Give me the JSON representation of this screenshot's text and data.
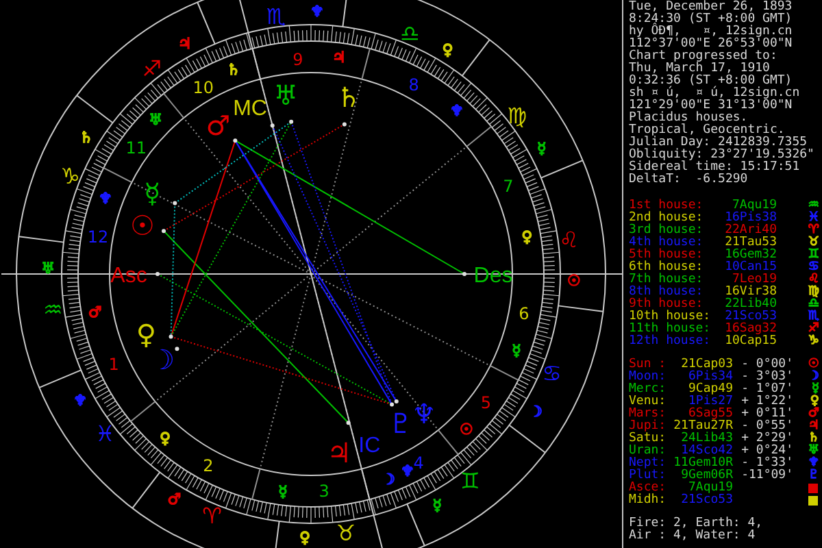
{
  "chart": {
    "signs": [
      {
        "glyph": "♈",
        "color": "#e00000",
        "ruler": {
          "glyph": "♂",
          "color": "#e00000"
        }
      },
      {
        "glyph": "♉",
        "color": "#d0d000",
        "ruler": {
          "glyph": "♀",
          "color": "#d0d000"
        }
      },
      {
        "glyph": "♊",
        "color": "#00c000",
        "ruler": {
          "glyph": "☿",
          "color": "#00c000"
        }
      },
      {
        "glyph": "♋",
        "color": "#1818ff",
        "ruler": {
          "glyph": "☽",
          "color": "#1818ff"
        }
      },
      {
        "glyph": "♌",
        "color": "#e00000",
        "ruler": {
          "glyph": "☉",
          "color": "#e00000"
        }
      },
      {
        "glyph": "♍",
        "color": "#d0d000",
        "ruler": {
          "glyph": "☿",
          "color": "#00c000"
        }
      },
      {
        "glyph": "♎",
        "color": "#00c000",
        "ruler": {
          "glyph": "♀",
          "color": "#d0d000"
        }
      },
      {
        "glyph": "♏",
        "color": "#1818ff",
        "ruler": {
          "glyph": "♆",
          "color": "#1818ff"
        }
      },
      {
        "glyph": "♐",
        "color": "#e00000",
        "ruler": {
          "glyph": "♃",
          "color": "#e00000"
        }
      },
      {
        "glyph": "♑",
        "color": "#d0d000",
        "ruler": {
          "glyph": "♄",
          "color": "#d0d000"
        }
      },
      {
        "glyph": "♒",
        "color": "#00c000",
        "ruler": {
          "glyph": "♅",
          "color": "#00c000"
        }
      },
      {
        "glyph": "♓",
        "color": "#1818ff",
        "ruler": {
          "glyph": "♆",
          "color": "#1818ff"
        }
      }
    ],
    "houses": [
      {
        "number": "1",
        "color": "#e00000",
        "rulers": [
          {
            "glyph": "♂",
            "color": "#e00000"
          }
        ]
      },
      {
        "number": "2",
        "color": "#d0d000",
        "rulers": [
          {
            "glyph": "♀",
            "color": "#d0d000"
          }
        ]
      },
      {
        "number": "3",
        "color": "#00c000",
        "rulers": [
          {
            "glyph": "☿",
            "color": "#00c000"
          }
        ]
      },
      {
        "number": "4",
        "color": "#1818ff",
        "rulers": [
          {
            "glyph": "☽",
            "color": "#1818ff"
          },
          {
            "glyph": "♆",
            "color": "#1818ff"
          }
        ]
      },
      {
        "number": "5",
        "color": "#e00000",
        "rulers": [
          {
            "glyph": "☉",
            "color": "#e00000"
          }
        ]
      },
      {
        "number": "6",
        "color": "#d0d000",
        "rulers": [
          {
            "glyph": "☿",
            "color": "#00c000"
          }
        ]
      },
      {
        "number": "7",
        "color": "#00c000",
        "rulers": [
          {
            "glyph": "♀",
            "color": "#d0d000"
          }
        ]
      },
      {
        "number": "8",
        "color": "#1818ff",
        "rulers": [
          {
            "glyph": "♆",
            "color": "#1818ff"
          }
        ]
      },
      {
        "number": "9",
        "color": "#e00000",
        "rulers": [
          {
            "glyph": "♃",
            "color": "#e00000"
          }
        ]
      },
      {
        "number": "10",
        "color": "#d0d000",
        "rulers": [
          {
            "glyph": "♄",
            "color": "#d0d000"
          }
        ]
      },
      {
        "number": "11",
        "color": "#00c000",
        "rulers": [
          {
            "glyph": "♅",
            "color": "#00c000"
          }
        ]
      },
      {
        "number": "12",
        "color": "#1818ff",
        "rulers": [
          {
            "glyph": "♆",
            "color": "#1818ff"
          }
        ]
      }
    ],
    "angles": [
      {
        "label": "Asc",
        "color": "#e00000"
      },
      {
        "label": "Des",
        "color": "#00c000"
      },
      {
        "label": "MC",
        "color": "#d0d000"
      },
      {
        "label": "IC",
        "color": "#1818ff"
      }
    ],
    "planets": [
      {
        "glyph": "☉",
        "color": "#e00000"
      },
      {
        "glyph": "☽",
        "color": "#1818ff"
      },
      {
        "glyph": "☿",
        "color": "#00c000"
      },
      {
        "glyph": "♀",
        "color": "#d0d000"
      },
      {
        "glyph": "♂",
        "color": "#e00000"
      },
      {
        "glyph": "♃",
        "color": "#e00000"
      },
      {
        "glyph": "♄",
        "color": "#d0d000"
      },
      {
        "glyph": "♅",
        "color": "#00c000"
      },
      {
        "glyph": "♆",
        "color": "#1818ff"
      },
      {
        "glyph": "♇",
        "color": "#1818ff"
      }
    ]
  },
  "info": [
    "Tue, December 26, 1893",
    "8:24:30 (ST +8:00 GMT)",
    "hy ÔÐ¶,   ¤, 12sign.cn",
    "112°37'00\"E 26°53'00\"N",
    "Chart progressed to:",
    "Thu, March 17, 1910",
    "0:32:36 (ST +8:00 GMT)",
    "sh ¤ ú,  ¤ ú, 12sign.cn",
    "121°29'00\"E 31°13'00\"N",
    "Placidus houses.",
    "Tropical, Geocentric.",
    "Julian Day: 2412839.7355",
    "Obliquity: 23°27'19.5326\"",
    "Sidereal time: 15:17:51",
    "DeltaT:  -6.5290"
  ],
  "houses": [
    {
      "label": {
        "text": "1st house:",
        "color": "#e00000"
      },
      "value": {
        "text": "7Aqu19",
        "color": "#00c000"
      },
      "glyph": {
        "text": "♒",
        "color": "#00c000"
      }
    },
    {
      "label": {
        "text": "2nd house:",
        "color": "#d0d000"
      },
      "value": {
        "text": "16Pis38",
        "color": "#1818ff"
      },
      "glyph": {
        "text": "♓",
        "color": "#1818ff"
      }
    },
    {
      "label": {
        "text": "3rd house:",
        "color": "#00c000"
      },
      "value": {
        "text": "22Ari40",
        "color": "#e00000"
      },
      "glyph": {
        "text": "♈",
        "color": "#e00000"
      }
    },
    {
      "label": {
        "text": "4th house:",
        "color": "#1818ff"
      },
      "value": {
        "text": "21Tau53",
        "color": "#d0d000"
      },
      "glyph": {
        "text": "♉",
        "color": "#d0d000"
      }
    },
    {
      "label": {
        "text": "5th house:",
        "color": "#e00000"
      },
      "value": {
        "text": "16Gem32",
        "color": "#00c000"
      },
      "glyph": {
        "text": "♊",
        "color": "#00c000"
      }
    },
    {
      "label": {
        "text": "6th house:",
        "color": "#d0d000"
      },
      "value": {
        "text": "10Can15",
        "color": "#1818ff"
      },
      "glyph": {
        "text": "♋",
        "color": "#1818ff"
      }
    },
    {
      "label": {
        "text": "7th house:",
        "color": "#00c000"
      },
      "value": {
        "text": "7Leo19",
        "color": "#e00000"
      },
      "glyph": {
        "text": "♌",
        "color": "#e00000"
      }
    },
    {
      "label": {
        "text": "8th house:",
        "color": "#1818ff"
      },
      "value": {
        "text": "16Vir38",
        "color": "#d0d000"
      },
      "glyph": {
        "text": "♍",
        "color": "#d0d000"
      }
    },
    {
      "label": {
        "text": "9th house:",
        "color": "#e00000"
      },
      "value": {
        "text": "22Lib40",
        "color": "#00c000"
      },
      "glyph": {
        "text": "♎",
        "color": "#00c000"
      }
    },
    {
      "label": {
        "text": "10th house:",
        "color": "#d0d000"
      },
      "value": {
        "text": "21Sco53",
        "color": "#1818ff"
      },
      "glyph": {
        "text": "♏",
        "color": "#1818ff"
      }
    },
    {
      "label": {
        "text": "11th house:",
        "color": "#00c000"
      },
      "value": {
        "text": "16Sag32",
        "color": "#e00000"
      },
      "glyph": {
        "text": "♐",
        "color": "#e00000"
      }
    },
    {
      "label": {
        "text": "12th house:",
        "color": "#1818ff"
      },
      "value": {
        "text": "10Cap15",
        "color": "#d0d000"
      },
      "glyph": {
        "text": "♑",
        "color": "#d0d000"
      }
    }
  ],
  "positions": [
    {
      "kind": "planet",
      "name": {
        "text": "Sun :",
        "color": "#e00000"
      },
      "value": {
        "text": "21Cap03",
        "color": "#d0d000"
      },
      "speed": "- 0°00'",
      "glyph": {
        "text": "☉",
        "color": "#e00000"
      }
    },
    {
      "kind": "planet",
      "name": {
        "text": "Moon:",
        "color": "#1818ff"
      },
      "value": {
        "text": "6Pis34",
        "color": "#1818ff"
      },
      "speed": "- 3°03'",
      "glyph": {
        "text": "☽",
        "color": "#1818ff"
      }
    },
    {
      "kind": "planet",
      "name": {
        "text": "Merc:",
        "color": "#00c000"
      },
      "value": {
        "text": "9Cap49",
        "color": "#d0d000"
      },
      "speed": "- 1°07'",
      "glyph": {
        "text": "☿",
        "color": "#00c000"
      }
    },
    {
      "kind": "planet",
      "name": {
        "text": "Venu:",
        "color": "#d0d000"
      },
      "value": {
        "text": "1Pis27",
        "color": "#1818ff"
      },
      "speed": "+ 1°22'",
      "glyph": {
        "text": "♀",
        "color": "#d0d000"
      }
    },
    {
      "kind": "planet",
      "name": {
        "text": "Mars:",
        "color": "#e00000"
      },
      "value": {
        "text": "6Sag55",
        "color": "#e00000"
      },
      "speed": "+ 0°11'",
      "glyph": {
        "text": "♂",
        "color": "#e00000"
      }
    },
    {
      "kind": "planet",
      "name": {
        "text": "Jupi:",
        "color": "#e00000"
      },
      "value": {
        "text": "21Tau27R",
        "color": "#d0d000"
      },
      "speed": "- 0°55'",
      "glyph": {
        "text": "♃",
        "color": "#e00000"
      }
    },
    {
      "kind": "planet",
      "name": {
        "text": "Satu:",
        "color": "#d0d000"
      },
      "value": {
        "text": "24Lib43",
        "color": "#00c000"
      },
      "speed": "+ 2°29'",
      "glyph": {
        "text": "♄",
        "color": "#d0d000"
      }
    },
    {
      "kind": "planet",
      "name": {
        "text": "Uran:",
        "color": "#00c000"
      },
      "value": {
        "text": "14Sco42",
        "color": "#1818ff"
      },
      "speed": "+ 0°24'",
      "glyph": {
        "text": "♅",
        "color": "#00c000"
      }
    },
    {
      "kind": "planet",
      "name": {
        "text": "Nept:",
        "color": "#1818ff"
      },
      "value": {
        "text": "11Gem10R",
        "color": "#00c000"
      },
      "speed": "- 1°33'",
      "glyph": {
        "text": "♆",
        "color": "#1818ff"
      }
    },
    {
      "kind": "planet",
      "name": {
        "text": "Plut:",
        "color": "#1818ff"
      },
      "value": {
        "text": "9Gem06R",
        "color": "#00c000"
      },
      "speed": "-11°09'",
      "glyph": {
        "text": "♇",
        "color": "#1818ff"
      }
    },
    {
      "kind": "angle",
      "name": {
        "text": "Asce:",
        "color": "#e00000"
      },
      "value": {
        "text": "7Aqu19",
        "color": "#00c000"
      }
    },
    {
      "kind": "angle",
      "name": {
        "text": "Midh:",
        "color": "#d0d000"
      },
      "value": {
        "text": "21Sco53",
        "color": "#1818ff"
      }
    }
  ],
  "elements": [
    "Fire: 2, Earth: 4,",
    "Air : 4, Water: 4"
  ]
}
